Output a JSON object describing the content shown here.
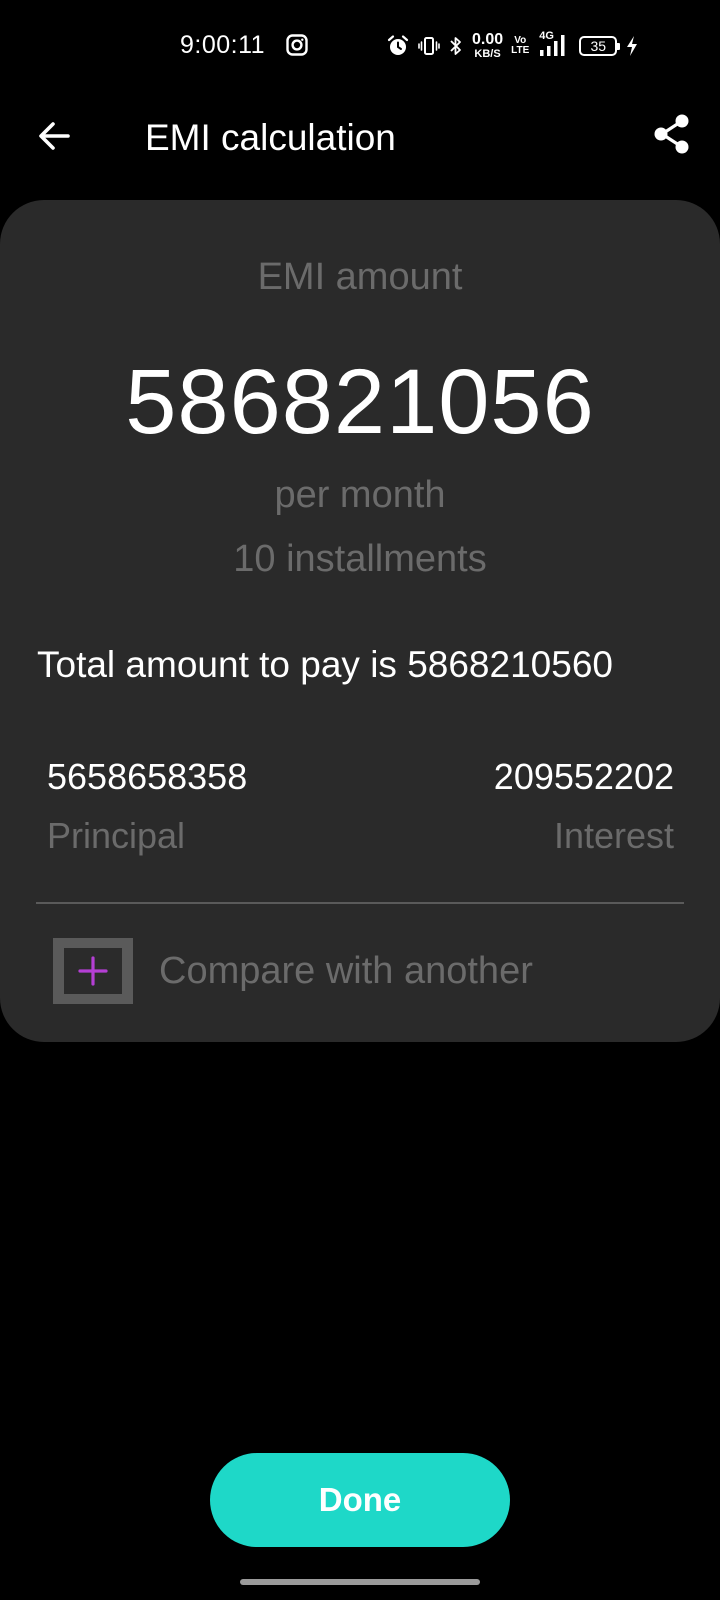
{
  "status_bar": {
    "time": "9:00:11",
    "net_speed_value": "0.00",
    "net_speed_unit": "KB/S",
    "volte_top": "Vo",
    "volte_bottom": "LTE",
    "network_type": "4G",
    "battery_level": "35",
    "icons": [
      "instagram-icon",
      "alarm-icon",
      "vibrate-icon",
      "bluetooth-icon",
      "signal-icon",
      "battery-icon",
      "charging-icon"
    ]
  },
  "app_bar": {
    "title": "EMI calculation",
    "back_icon": "arrow-left-icon",
    "share_icon": "share-icon"
  },
  "result": {
    "emi_label": "EMI amount",
    "emi_value": "586821056",
    "per_month": "per month",
    "installments": "10 installments",
    "total_line": "Total amount to pay is 5868210560",
    "principal_value": "5658658358",
    "principal_label": "Principal",
    "interest_value": "209552202",
    "interest_label": "Interest",
    "compare_label": "Compare with another"
  },
  "footer": {
    "done_label": "Done"
  },
  "colors": {
    "background": "#000000",
    "card": "#2a2a2a",
    "muted_text": "#6b6b6b",
    "accent_button": "#1ed8c8",
    "plus_accent": "#b43fd4"
  }
}
